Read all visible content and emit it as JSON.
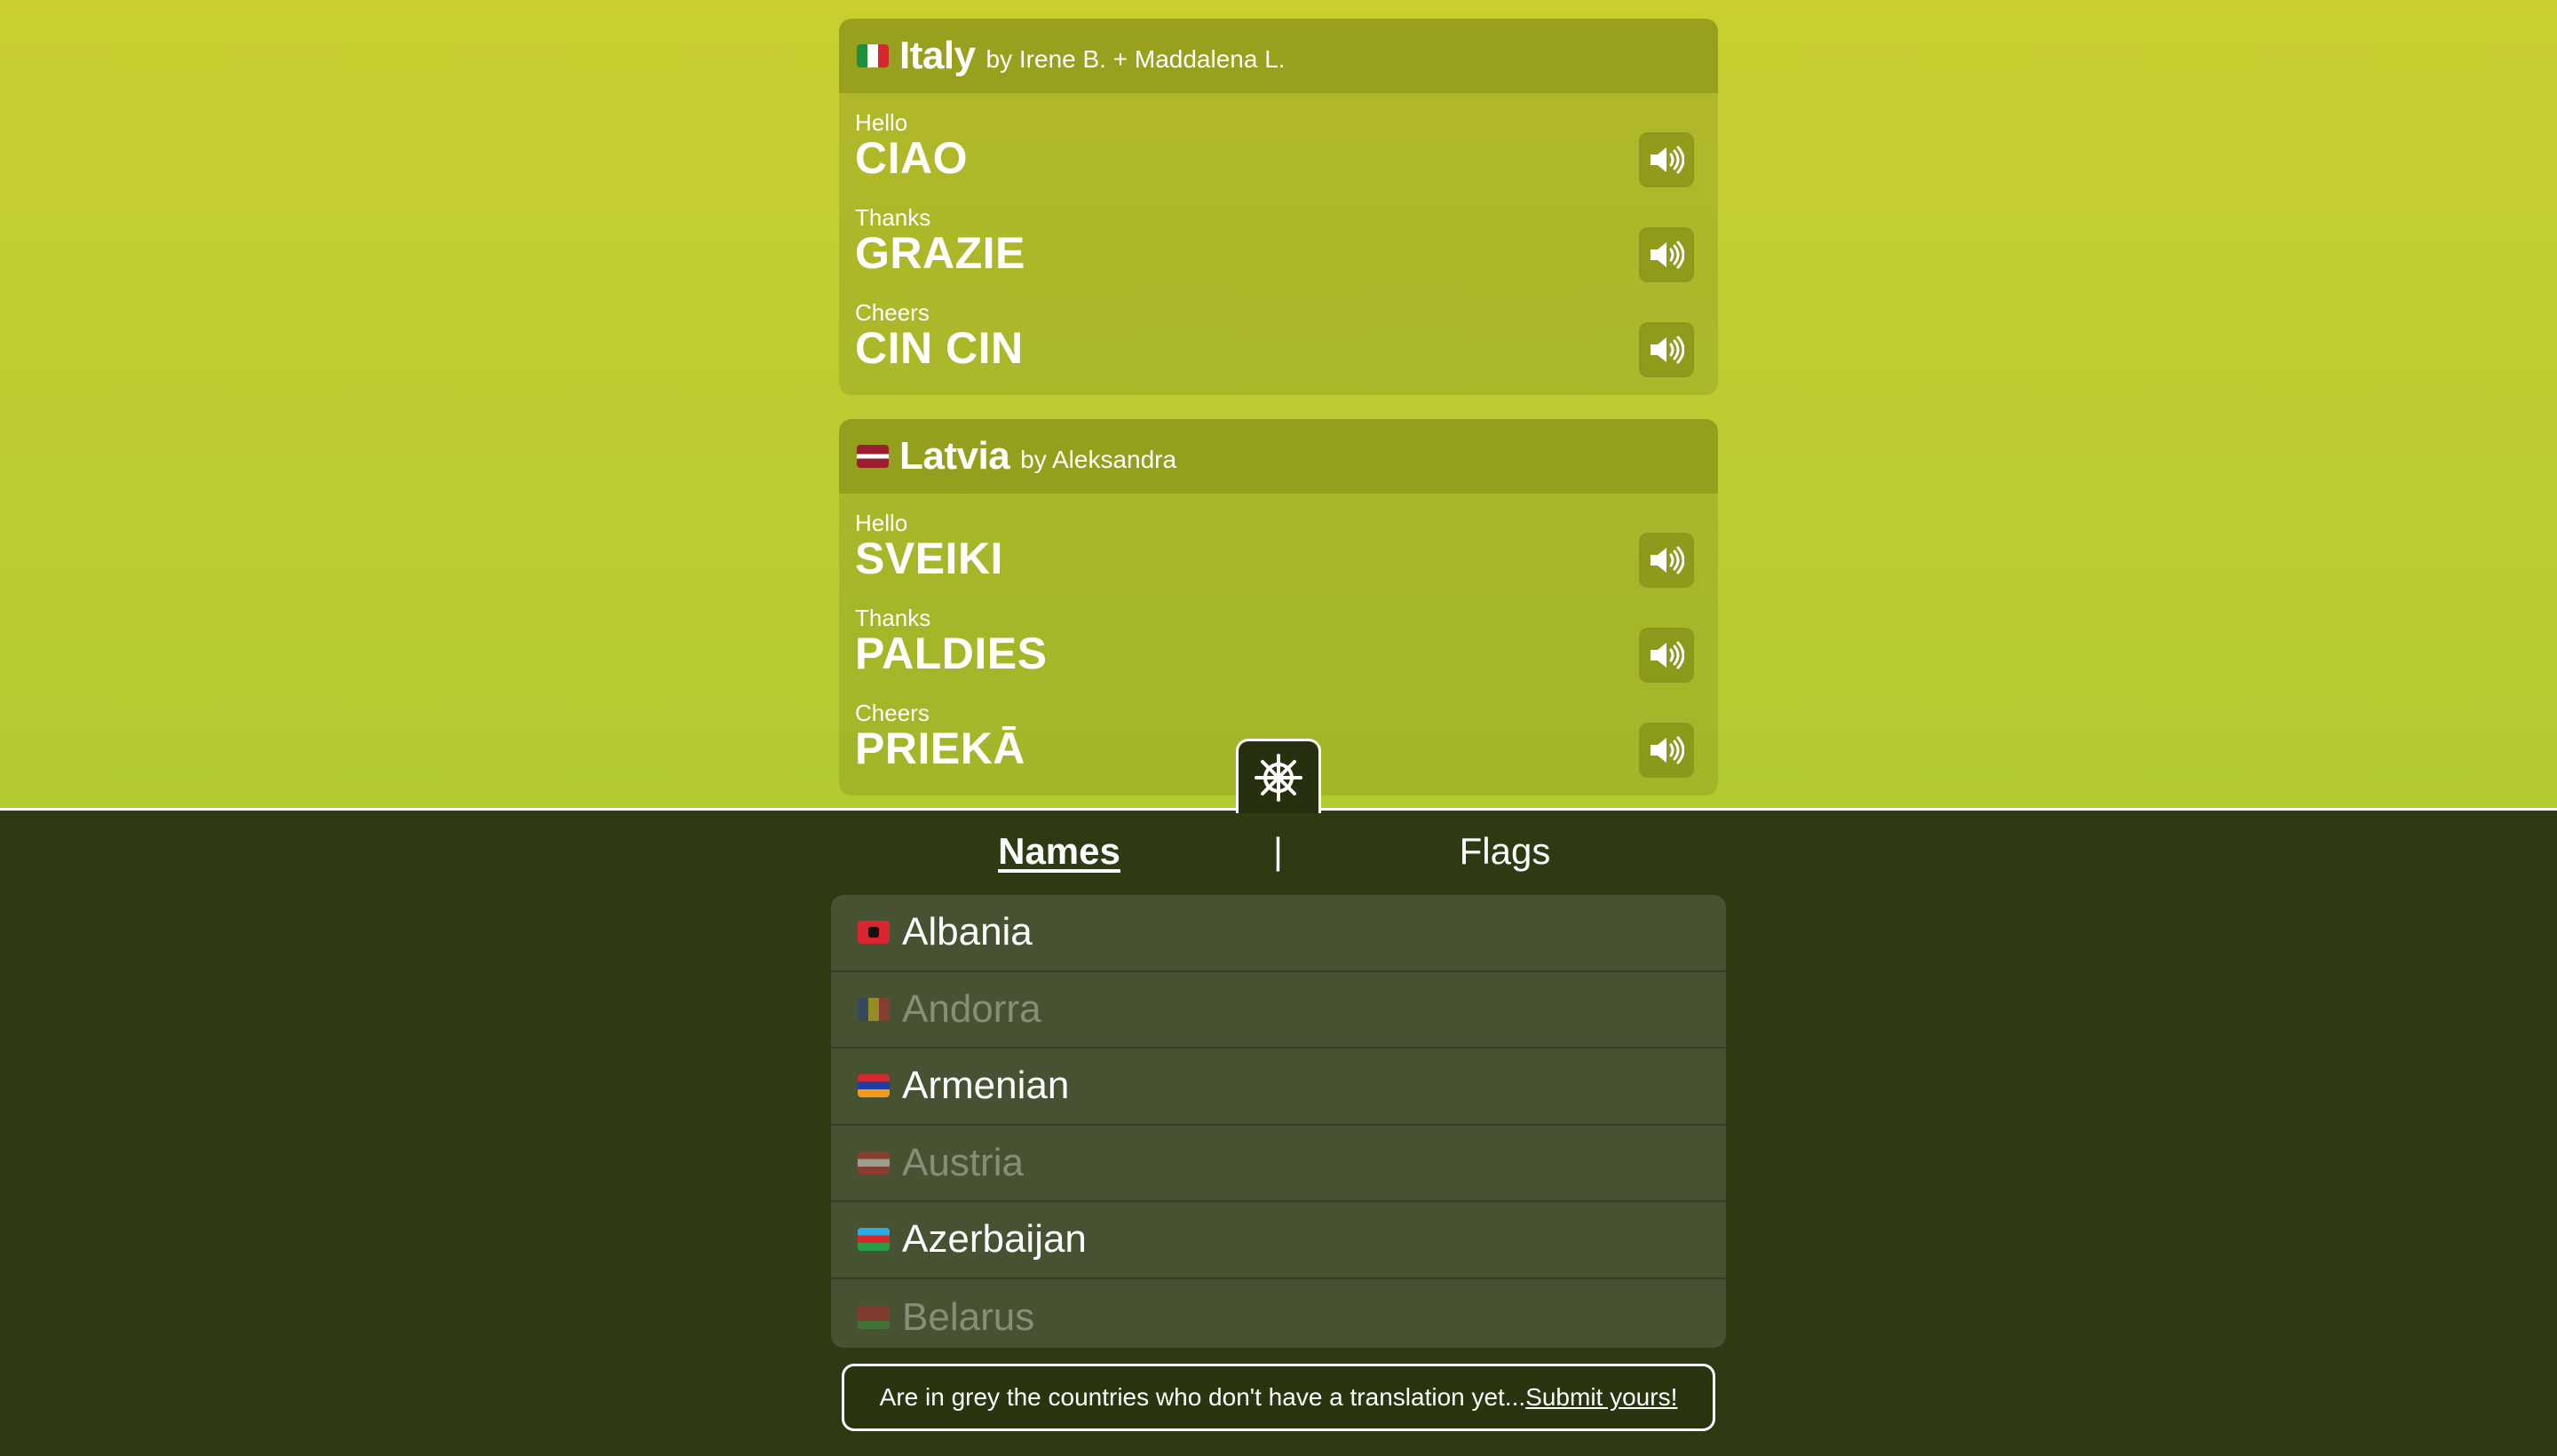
{
  "cards": [
    {
      "country": "Italy",
      "flag_icon": "italy-flag-icon",
      "authors": "by Irene B. + Maddalena L.",
      "rows": [
        {
          "label": "Hello",
          "word": "CIAO"
        },
        {
          "label": "Thanks",
          "word": "GRAZIE"
        },
        {
          "label": "Cheers",
          "word": "CIN CIN"
        }
      ]
    },
    {
      "country": "Latvia",
      "flag_icon": "latvia-flag-icon",
      "authors": "by Aleksandra",
      "rows": [
        {
          "label": "Hello",
          "word": "SVEIKI"
        },
        {
          "label": "Thanks",
          "word": "PALDIES"
        },
        {
          "label": "Cheers",
          "word": "PRIEKĀ"
        }
      ]
    }
  ],
  "panel": {
    "handle_icon": "ship-wheel-icon",
    "tabs": {
      "names": "Names",
      "separator": "|",
      "flags": "Flags"
    },
    "countries": [
      {
        "name": "Albania",
        "available": true
      },
      {
        "name": "Andorra",
        "available": false
      },
      {
        "name": "Armenian",
        "available": true
      },
      {
        "name": "Austria",
        "available": false
      },
      {
        "name": "Azerbaijan",
        "available": true
      },
      {
        "name": "Belarus",
        "available": false
      }
    ],
    "notice": {
      "text": "Are in grey the countries who don't have a translation yet...",
      "link": "Submit yours!"
    }
  },
  "colors": {
    "background_top": "#c9cf31",
    "background_bottom": "#9ec72f",
    "panel": "#2e3b12"
  }
}
